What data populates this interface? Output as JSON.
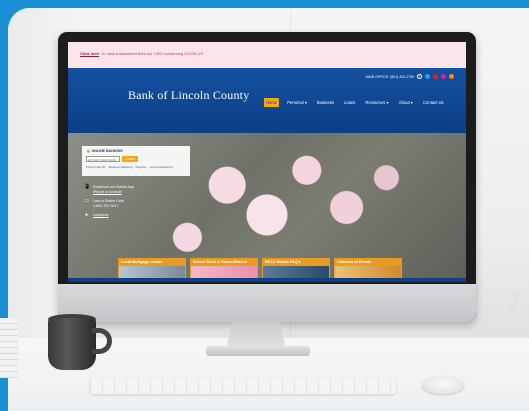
{
  "alert": {
    "link_text": "Click here",
    "message": "to view a statement from our CEO concerning COVID-19"
  },
  "header": {
    "main_office": "MAIN OFFICE: (501) 403-1700",
    "logo_text": "Bank of Lincoln County",
    "social_icons": [
      "facebook-icon",
      "twitter-icon",
      "youtube-icon",
      "instagram-icon",
      "linkedin-icon"
    ]
  },
  "nav": {
    "items": [
      {
        "label": "Home",
        "active": true
      },
      {
        "label": "Personal ▾",
        "active": false
      },
      {
        "label": "Business",
        "active": false
      },
      {
        "label": "Loans",
        "active": false
      },
      {
        "label": "Resources ▾",
        "active": false
      },
      {
        "label": "About ▾",
        "active": false
      },
      {
        "label": "Contact Us",
        "active": false
      }
    ]
  },
  "login": {
    "title": "ONLINE BANKING",
    "placeholder": "ENTER USERNAME",
    "button": "LOGIN",
    "links": [
      "Forgot User ID",
      "Business Banking",
      "Register",
      "Forgot Password"
    ]
  },
  "info": {
    "mobile_title": "Download our Mobile App:",
    "mobile_links": "iPhone or Android",
    "lost_card_title": "Lost or Stolen Card",
    "lost_card_phone": "1-800-757-0017",
    "locations": "Locations"
  },
  "tiles": [
    {
      "label": "Local Mortgage Lender"
    },
    {
      "label": "School Bank & Patron Branch"
    },
    {
      "label": "BOLC Mobile FAQ's"
    },
    {
      "label": "Calendar of Events"
    }
  ],
  "colors": {
    "header_blue": "#1450a0",
    "accent_orange": "#f2a81d",
    "alert_pink": "#fbe5ea",
    "frame_blue": "#1a8fd6"
  }
}
